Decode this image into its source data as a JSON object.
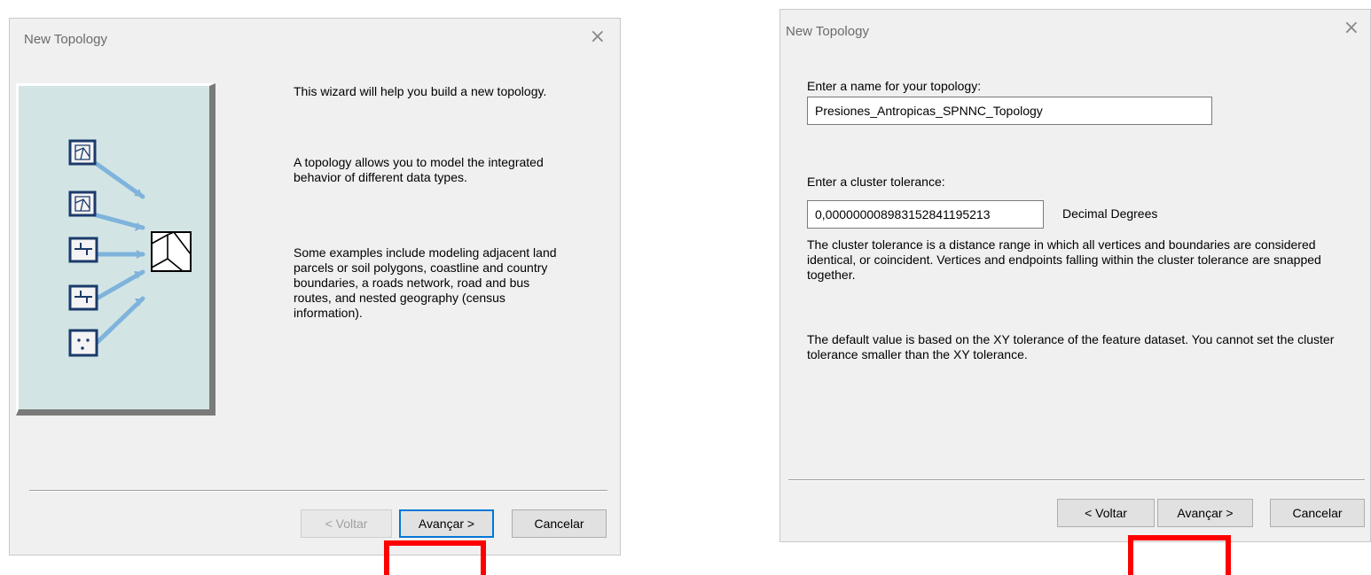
{
  "dialog1": {
    "title": "New Topology",
    "close_glyph": "×",
    "paragraphs": [
      "This wizard will help you build a new topology.",
      "A topology allows you to model the integrated behavior of different data types.",
      "Some examples include modeling adjacent land parcels or soil polygons, coastline and country boundaries, a roads network, road and bus routes, and nested geography (census information)."
    ],
    "buttons": {
      "back": "< Voltar",
      "next": "Avançar >",
      "cancel": "Cancelar"
    },
    "illustration_icons": [
      "polygon-icon",
      "polygon-icon",
      "line-icon",
      "line-icon",
      "point-icon",
      "topology-icon"
    ]
  },
  "dialog2": {
    "title": "New Topology",
    "close_glyph": "×",
    "name_label": "Enter a name for your topology:",
    "name_value": "Presiones_Antropicas_SPNNC_Topology",
    "tolerance_label": "Enter a cluster tolerance:",
    "tolerance_value": "0,000000008983152841195213",
    "tolerance_unit": "Decimal Degrees",
    "desc1": "The cluster tolerance is a distance range in which all vertices and boundaries are considered identical, or coincident. Vertices and endpoints falling within the cluster tolerance are snapped together.",
    "desc2": "The default value is based on the XY tolerance of the feature dataset. You cannot set the cluster tolerance smaller than the XY tolerance.",
    "buttons": {
      "back": "< Voltar",
      "next": "Avançar >",
      "cancel": "Cancelar"
    }
  },
  "colors": {
    "highlight": "#ff0000",
    "dialog_bg": "#f0f0f0",
    "illustration_bg": "#d2e5e4",
    "focus_border": "#0078d7"
  }
}
